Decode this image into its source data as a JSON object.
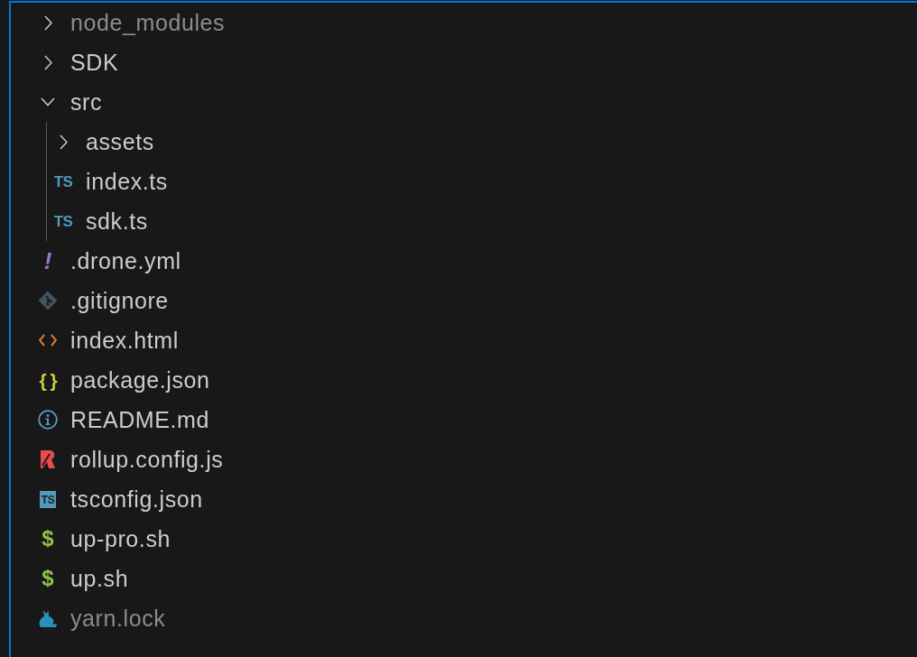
{
  "explorer": {
    "items": [
      {
        "kind": "folder",
        "name": "node_modules",
        "expanded": false,
        "ignored": true
      },
      {
        "kind": "folder",
        "name": "SDK",
        "expanded": false,
        "ignored": false
      },
      {
        "kind": "folder",
        "name": "src",
        "expanded": true,
        "ignored": false,
        "children": [
          {
            "kind": "folder",
            "name": "assets",
            "expanded": false,
            "ignored": false
          },
          {
            "kind": "typescript",
            "name": "index.ts",
            "glyph": "TS",
            "ignored": false
          },
          {
            "kind": "typescript",
            "name": "sdk.ts",
            "glyph": "TS",
            "ignored": false
          }
        ]
      },
      {
        "kind": "yaml",
        "name": ".drone.yml",
        "glyph": "!",
        "ignored": false
      },
      {
        "kind": "git",
        "name": ".gitignore",
        "ignored": false
      },
      {
        "kind": "html",
        "name": "index.html",
        "ignored": false
      },
      {
        "kind": "json",
        "name": "package.json",
        "glyph": "{ }",
        "ignored": false
      },
      {
        "kind": "info",
        "name": "README.md",
        "ignored": false
      },
      {
        "kind": "rollup",
        "name": "rollup.config.js",
        "ignored": false
      },
      {
        "kind": "tsconfig",
        "name": "tsconfig.json",
        "glyph": "TS",
        "ignored": false
      },
      {
        "kind": "shell",
        "name": "up-pro.sh",
        "glyph": "$",
        "ignored": false
      },
      {
        "kind": "shell",
        "name": "up.sh",
        "glyph": "$",
        "ignored": false
      },
      {
        "kind": "yarn",
        "name": "yarn.lock",
        "ignored": true
      }
    ]
  }
}
